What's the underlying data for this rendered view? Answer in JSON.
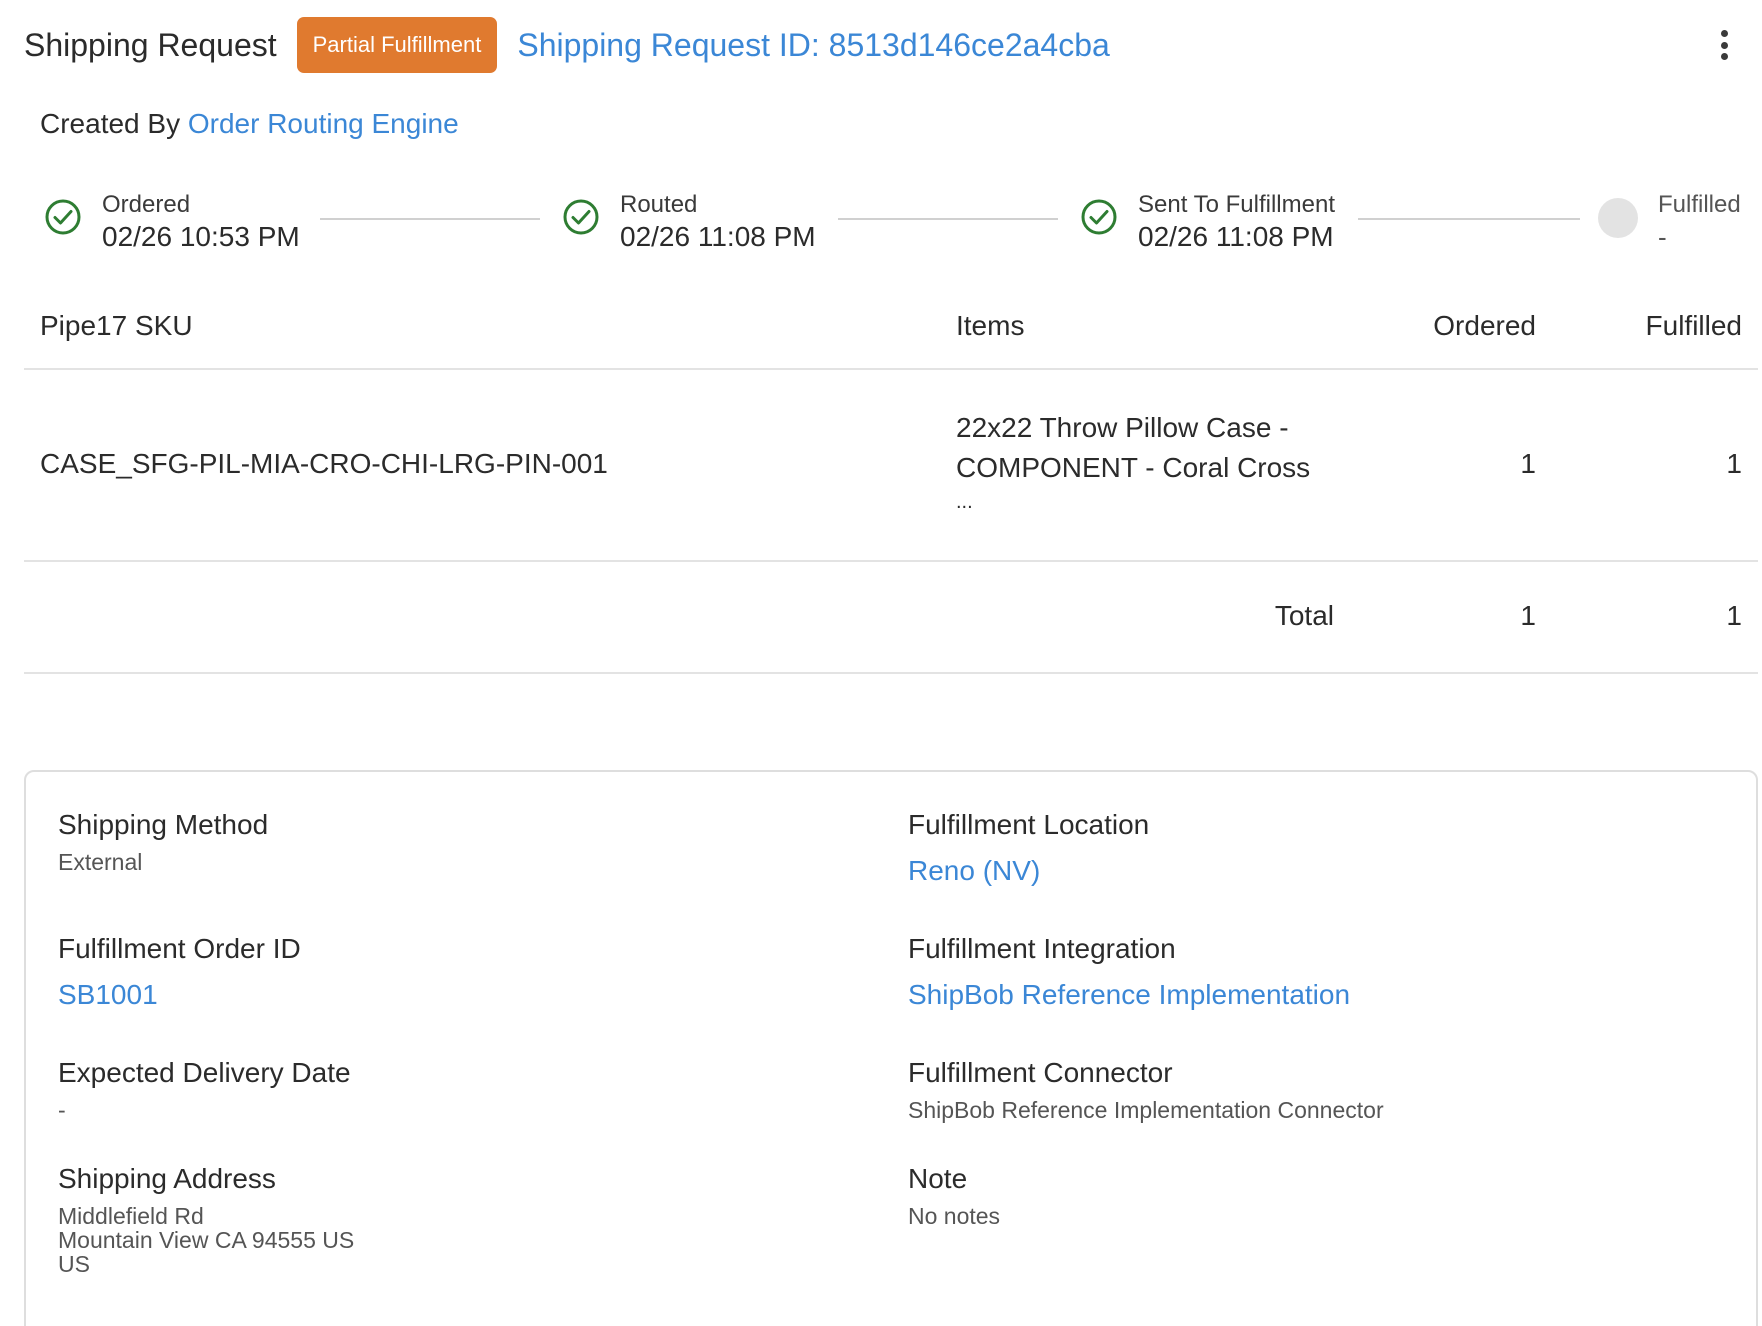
{
  "header": {
    "title": "Shipping Request",
    "status_badge": "Partial Fulfillment",
    "request_id": "Shipping Request ID: 8513d146ce2a4cba"
  },
  "created": {
    "prefix": "Created By",
    "by": "Order Routing Engine"
  },
  "steps": [
    {
      "label": "Ordered",
      "date": "02/26 10:53 PM",
      "done": true
    },
    {
      "label": "Routed",
      "date": "02/26 11:08 PM",
      "done": true
    },
    {
      "label": "Sent To Fulfillment",
      "date": "02/26 11:08 PM",
      "done": true
    },
    {
      "label": "Fulfilled",
      "date": "-",
      "done": false
    }
  ],
  "table": {
    "headers": [
      "Pipe17 SKU",
      "Items",
      "Ordered",
      "Fulfilled"
    ],
    "rows": [
      {
        "sku": "CASE_SFG-PIL-MIA-CRO-CHI-LRG-PIN-001",
        "item_line1": "22x22 Throw Pillow Case -",
        "item_line2": "COMPONENT - Coral Cross",
        "item_line3": "...",
        "ordered": "1",
        "fulfilled": "1"
      }
    ],
    "total": {
      "label": "Total",
      "ordered": "1",
      "fulfilled": "1"
    }
  },
  "details": {
    "shipping_method": {
      "label": "Shipping Method",
      "value": "External"
    },
    "fulfillment_order_id": {
      "label": "Fulfillment Order ID",
      "value": "SB1001"
    },
    "expected_delivery": {
      "label": "Expected Delivery Date",
      "value": "-"
    },
    "shipping_address": {
      "label": "Shipping Address",
      "line1": "Middlefield Rd",
      "line2": "Mountain View CA 94555 US",
      "line3": "US"
    },
    "fulfillment_location": {
      "label": "Fulfillment Location",
      "value": "Reno (NV)"
    },
    "fulfillment_integration": {
      "label": "Fulfillment Integration",
      "value": "ShipBob Reference Implementation"
    },
    "fulfillment_connector": {
      "label": "Fulfillment Connector",
      "value": "ShipBob Reference Implementation Connector"
    },
    "note": {
      "label": "Note",
      "value": "No notes"
    }
  },
  "colors": {
    "accent": "#3b87d6",
    "badge": "#e07a2f",
    "success": "#2e7d32"
  },
  "icons": {
    "step_done": "check-circle-icon",
    "step_pending": "pending-circle-icon",
    "menu": "more-vertical-icon"
  }
}
